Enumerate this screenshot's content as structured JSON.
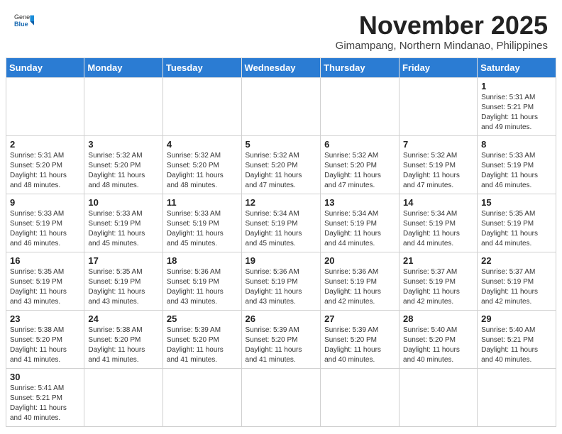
{
  "header": {
    "logo_general": "General",
    "logo_blue": "Blue",
    "month_title": "November 2025",
    "subtitle": "Gimampang, Northern Mindanao, Philippines"
  },
  "weekdays": [
    "Sunday",
    "Monday",
    "Tuesday",
    "Wednesday",
    "Thursday",
    "Friday",
    "Saturday"
  ],
  "weeks": [
    [
      {
        "day": "",
        "info": ""
      },
      {
        "day": "",
        "info": ""
      },
      {
        "day": "",
        "info": ""
      },
      {
        "day": "",
        "info": ""
      },
      {
        "day": "",
        "info": ""
      },
      {
        "day": "",
        "info": ""
      },
      {
        "day": "1",
        "info": "Sunrise: 5:31 AM\nSunset: 5:21 PM\nDaylight: 11 hours\nand 49 minutes."
      }
    ],
    [
      {
        "day": "2",
        "info": "Sunrise: 5:31 AM\nSunset: 5:20 PM\nDaylight: 11 hours\nand 48 minutes."
      },
      {
        "day": "3",
        "info": "Sunrise: 5:32 AM\nSunset: 5:20 PM\nDaylight: 11 hours\nand 48 minutes."
      },
      {
        "day": "4",
        "info": "Sunrise: 5:32 AM\nSunset: 5:20 PM\nDaylight: 11 hours\nand 48 minutes."
      },
      {
        "day": "5",
        "info": "Sunrise: 5:32 AM\nSunset: 5:20 PM\nDaylight: 11 hours\nand 47 minutes."
      },
      {
        "day": "6",
        "info": "Sunrise: 5:32 AM\nSunset: 5:20 PM\nDaylight: 11 hours\nand 47 minutes."
      },
      {
        "day": "7",
        "info": "Sunrise: 5:32 AM\nSunset: 5:19 PM\nDaylight: 11 hours\nand 47 minutes."
      },
      {
        "day": "8",
        "info": "Sunrise: 5:33 AM\nSunset: 5:19 PM\nDaylight: 11 hours\nand 46 minutes."
      }
    ],
    [
      {
        "day": "9",
        "info": "Sunrise: 5:33 AM\nSunset: 5:19 PM\nDaylight: 11 hours\nand 46 minutes."
      },
      {
        "day": "10",
        "info": "Sunrise: 5:33 AM\nSunset: 5:19 PM\nDaylight: 11 hours\nand 45 minutes."
      },
      {
        "day": "11",
        "info": "Sunrise: 5:33 AM\nSunset: 5:19 PM\nDaylight: 11 hours\nand 45 minutes."
      },
      {
        "day": "12",
        "info": "Sunrise: 5:34 AM\nSunset: 5:19 PM\nDaylight: 11 hours\nand 45 minutes."
      },
      {
        "day": "13",
        "info": "Sunrise: 5:34 AM\nSunset: 5:19 PM\nDaylight: 11 hours\nand 44 minutes."
      },
      {
        "day": "14",
        "info": "Sunrise: 5:34 AM\nSunset: 5:19 PM\nDaylight: 11 hours\nand 44 minutes."
      },
      {
        "day": "15",
        "info": "Sunrise: 5:35 AM\nSunset: 5:19 PM\nDaylight: 11 hours\nand 44 minutes."
      }
    ],
    [
      {
        "day": "16",
        "info": "Sunrise: 5:35 AM\nSunset: 5:19 PM\nDaylight: 11 hours\nand 43 minutes."
      },
      {
        "day": "17",
        "info": "Sunrise: 5:35 AM\nSunset: 5:19 PM\nDaylight: 11 hours\nand 43 minutes."
      },
      {
        "day": "18",
        "info": "Sunrise: 5:36 AM\nSunset: 5:19 PM\nDaylight: 11 hours\nand 43 minutes."
      },
      {
        "day": "19",
        "info": "Sunrise: 5:36 AM\nSunset: 5:19 PM\nDaylight: 11 hours\nand 43 minutes."
      },
      {
        "day": "20",
        "info": "Sunrise: 5:36 AM\nSunset: 5:19 PM\nDaylight: 11 hours\nand 42 minutes."
      },
      {
        "day": "21",
        "info": "Sunrise: 5:37 AM\nSunset: 5:19 PM\nDaylight: 11 hours\nand 42 minutes."
      },
      {
        "day": "22",
        "info": "Sunrise: 5:37 AM\nSunset: 5:19 PM\nDaylight: 11 hours\nand 42 minutes."
      }
    ],
    [
      {
        "day": "23",
        "info": "Sunrise: 5:38 AM\nSunset: 5:20 PM\nDaylight: 11 hours\nand 41 minutes."
      },
      {
        "day": "24",
        "info": "Sunrise: 5:38 AM\nSunset: 5:20 PM\nDaylight: 11 hours\nand 41 minutes."
      },
      {
        "day": "25",
        "info": "Sunrise: 5:39 AM\nSunset: 5:20 PM\nDaylight: 11 hours\nand 41 minutes."
      },
      {
        "day": "26",
        "info": "Sunrise: 5:39 AM\nSunset: 5:20 PM\nDaylight: 11 hours\nand 41 minutes."
      },
      {
        "day": "27",
        "info": "Sunrise: 5:39 AM\nSunset: 5:20 PM\nDaylight: 11 hours\nand 40 minutes."
      },
      {
        "day": "28",
        "info": "Sunrise: 5:40 AM\nSunset: 5:20 PM\nDaylight: 11 hours\nand 40 minutes."
      },
      {
        "day": "29",
        "info": "Sunrise: 5:40 AM\nSunset: 5:21 PM\nDaylight: 11 hours\nand 40 minutes."
      }
    ],
    [
      {
        "day": "30",
        "info": "Sunrise: 5:41 AM\nSunset: 5:21 PM\nDaylight: 11 hours\nand 40 minutes."
      },
      {
        "day": "",
        "info": ""
      },
      {
        "day": "",
        "info": ""
      },
      {
        "day": "",
        "info": ""
      },
      {
        "day": "",
        "info": ""
      },
      {
        "day": "",
        "info": ""
      },
      {
        "day": "",
        "info": ""
      }
    ]
  ]
}
